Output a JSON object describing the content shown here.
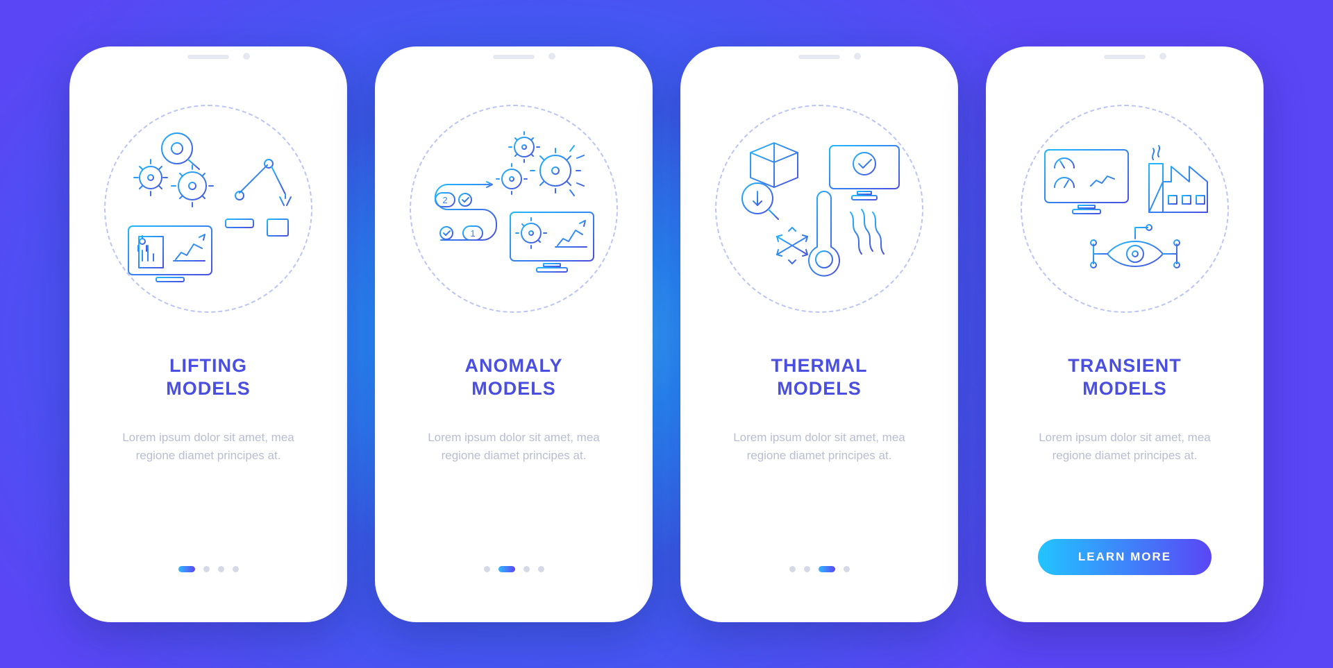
{
  "screens": [
    {
      "title": "LIFTING\nMODELS",
      "desc": "Lorem ipsum dolor sit amet, mea regione diamet principes at.",
      "activeDot": 0,
      "icon": "lifting-icon"
    },
    {
      "title": "ANOMALY\nMODELS",
      "desc": "Lorem ipsum dolor sit amet, mea regione diamet principes at.",
      "activeDot": 1,
      "icon": "anomaly-icon"
    },
    {
      "title": "THERMAL\nMODELS",
      "desc": "Lorem ipsum dolor sit amet, mea regione diamet principes at.",
      "activeDot": 2,
      "icon": "thermal-icon"
    },
    {
      "title": "TRANSIENT\nMODELS",
      "desc": "Lorem ipsum dolor sit amet, mea regione diamet principes at.",
      "activeDot": 3,
      "icon": "transient-icon",
      "cta": "LEARN MORE"
    }
  ],
  "dotCount": 4,
  "colors": {
    "gradStart": "#1fb8ff",
    "gradEnd": "#4a4fe0"
  }
}
